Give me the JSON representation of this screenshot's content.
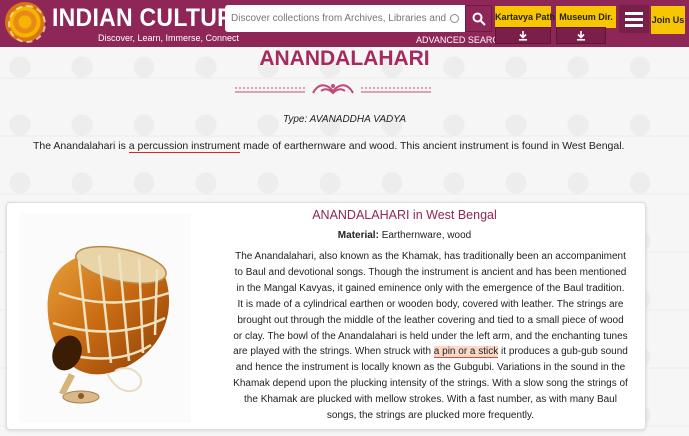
{
  "header": {
    "brand_title": "INDIAN CULTURE",
    "tagline": "Discover, Learn, Immerse, Connect",
    "search_placeholder": "Discover collections from Archives, Libraries and Museums",
    "advanced_search": "ADVANCED SEARCH",
    "kartavya_path": "Kartavya Path",
    "museum_dir": "Museum Dir.",
    "join_us": "Join Us",
    "colors": {
      "header_bg": "#8e2657",
      "accent_yellow": "#f7c600",
      "title_color": "#a52a5e"
    }
  },
  "page": {
    "title": "ANANDALAHARI",
    "type_line": "Type: AVANADDHA VADYA",
    "intro_before": "The Anandalahari is ",
    "intro_link": "a percussion instrument",
    "intro_after": " made of earthernware and wood. This ancient instrument is found in West Bengal."
  },
  "card": {
    "title": "ANANDALAHARI in West Bengal",
    "material_label": "Material:",
    "material_value": " Earthernware, wood",
    "description_before": "The Anandalahari, also known as the Khamak, has traditionally been an accompaniment to Baul and devotional songs. Though the instrument is ancient and has been mentioned in the Mangal Kavyas, it gained eminence only with the emergence of the Baul tradition. It is made of a cylindrical earthen or wooden body, covered with leather. The strings are brought out through the middle of the leather covering and tied to a small piece of wood or clay. The bowl of the Anandalahari is held under the left arm, and the enchanting tunes are played with the strings. When struck with ",
    "description_highlight": "a pin or a stick",
    "description_after": " it produces a gub-gub sound and hence the instrument is locally known as the Gubgubi. Variations in the sound in the Khamak depend upon the plucking intensity of the strings. With a slow song the strings of the Khamak are plucked with mellow strokes. With a fast number, as with many Baul songs, the strings are plucked more frequently."
  },
  "icons": [
    "logo-emblem",
    "clear-icon",
    "search-icon",
    "download-icon",
    "menu-icon",
    "ornament-divider",
    "instrument-image"
  ]
}
